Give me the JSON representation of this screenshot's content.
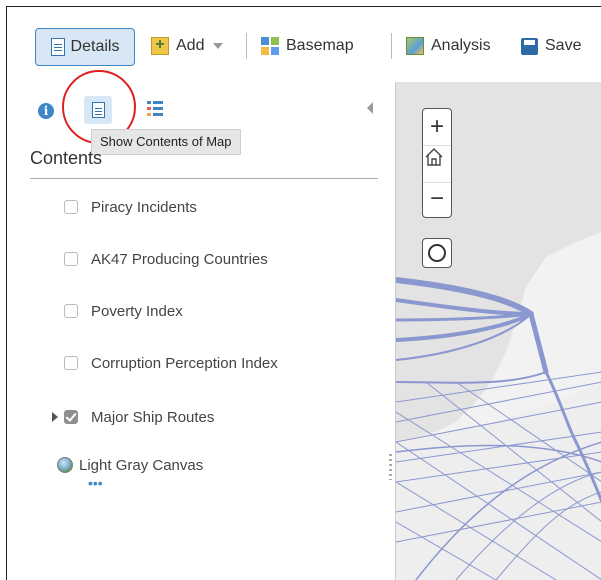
{
  "toolbar": {
    "details_label": "Details",
    "add_label": "Add",
    "basemap_label": "Basemap",
    "analysis_label": "Analysis",
    "save_label": "Save"
  },
  "panel": {
    "tooltip": "Show Contents of Map",
    "title": "Contents",
    "layers": [
      {
        "label": "Piracy Incidents",
        "checked": false
      },
      {
        "label": "AK47 Producing Countries",
        "checked": false
      },
      {
        "label": "Poverty Index",
        "checked": false
      },
      {
        "label": "Corruption Perception Index",
        "checked": false
      },
      {
        "label": "Major Ship Routes",
        "checked": true,
        "expandable": true
      }
    ],
    "basemap_label": "Light Gray Canvas",
    "basemap_more": "•••"
  },
  "map": {
    "zoom_in": "+",
    "zoom_out": "−",
    "route_color": "#8b97cf",
    "land_color": "#e3e3e3",
    "water_color": "#f4f4f4"
  },
  "colors": {
    "accent": "#3d87c7",
    "highlight": "#e02020"
  }
}
